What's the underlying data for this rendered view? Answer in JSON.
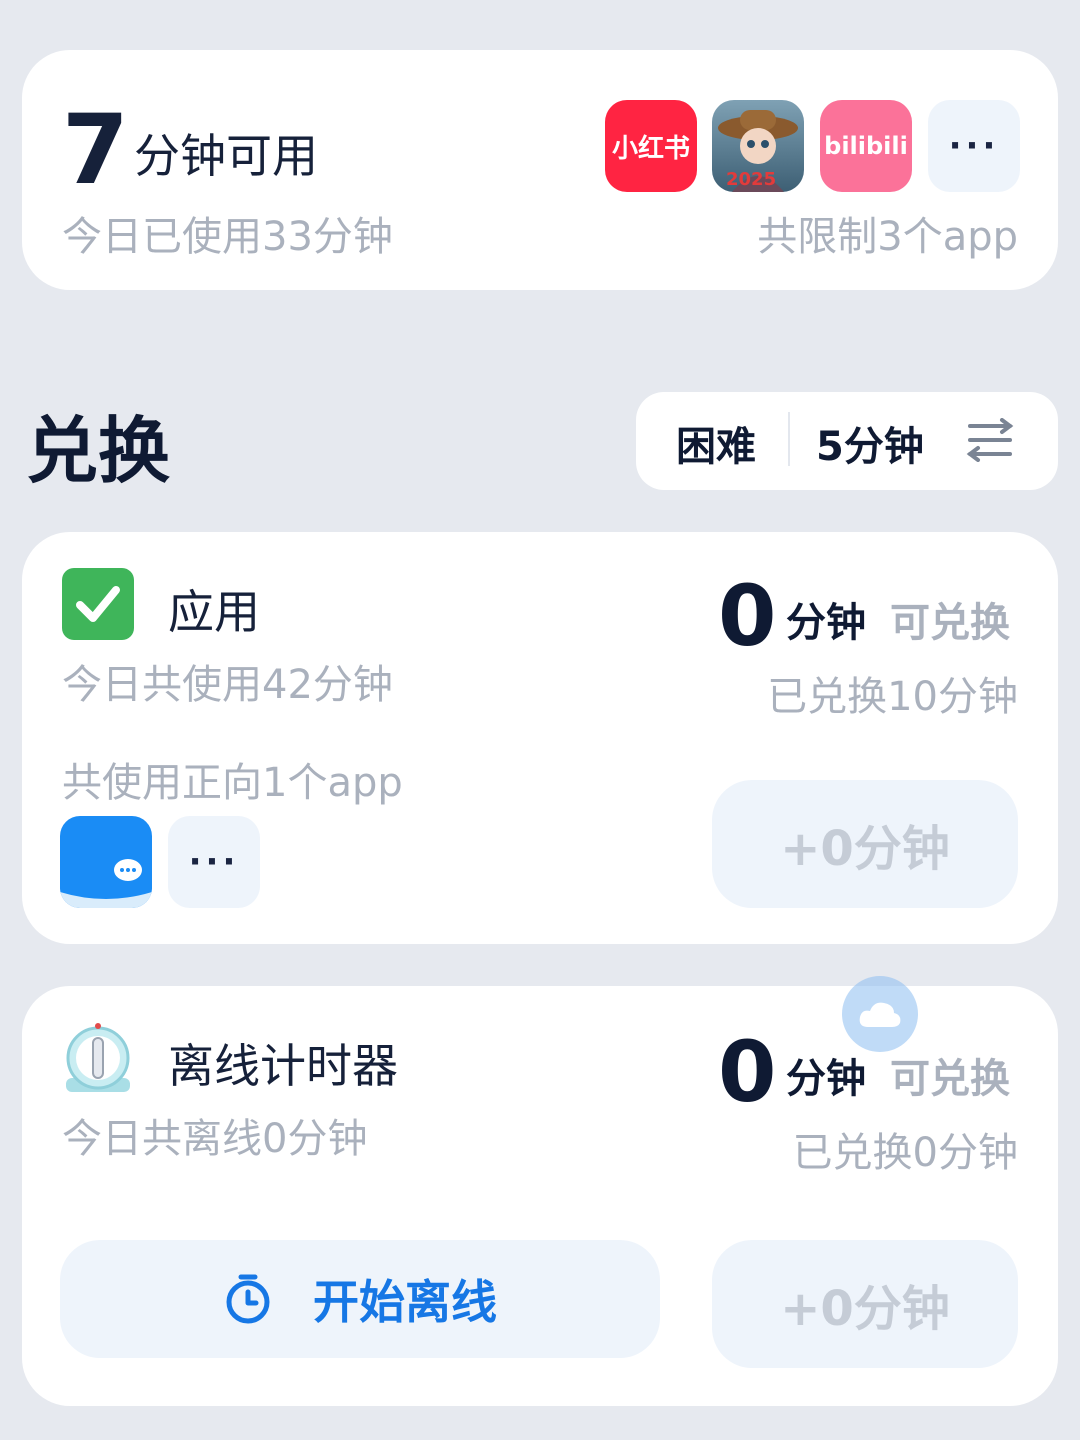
{
  "limit_card": {
    "available_minutes": "7",
    "available_label": "分钟可用",
    "used_today": "今日已使用33分钟",
    "limited_apps_text": "共限制3个app",
    "apps": [
      {
        "name": "小红书",
        "icon": "xiaohongshu-icon",
        "color": "#ff2442"
      },
      {
        "name": "2025",
        "icon": "identity-v-game-icon",
        "color": "#3d5f74"
      },
      {
        "name": "bilibili",
        "icon": "bilibili-icon",
        "color": "#fb7299"
      }
    ],
    "more_label": "···"
  },
  "exchange": {
    "title": "兑换",
    "difficulty": "困难",
    "duration": "5分钟",
    "settings_icon": "sliders-icon"
  },
  "app_card": {
    "check_icon": "checkmark-icon",
    "title": "应用",
    "used_today": "今日共使用42分钟",
    "positive_apps_text": "共使用正向1个app",
    "redeemable_num": "0",
    "unit": "分钟",
    "redeemable_label": "可兑换",
    "redeemed": "已兑换10分钟",
    "plus_button": "+0分钟",
    "more_label": "···"
  },
  "offline_card": {
    "timer_icon": "kitchen-timer-icon",
    "title": "离线计时器",
    "offline_today": "今日共离线0分钟",
    "redeemable_num": "0",
    "unit": "分钟",
    "redeemable_label": "可兑换",
    "redeemed": "已兑换0分钟",
    "start_button": "开始离线",
    "plus_button": "+0分钟"
  },
  "colors": {
    "background": "#e6e9ef",
    "card": "#ffffff",
    "accent_blue": "#1677e5",
    "muted_button": "#eef4fb"
  }
}
